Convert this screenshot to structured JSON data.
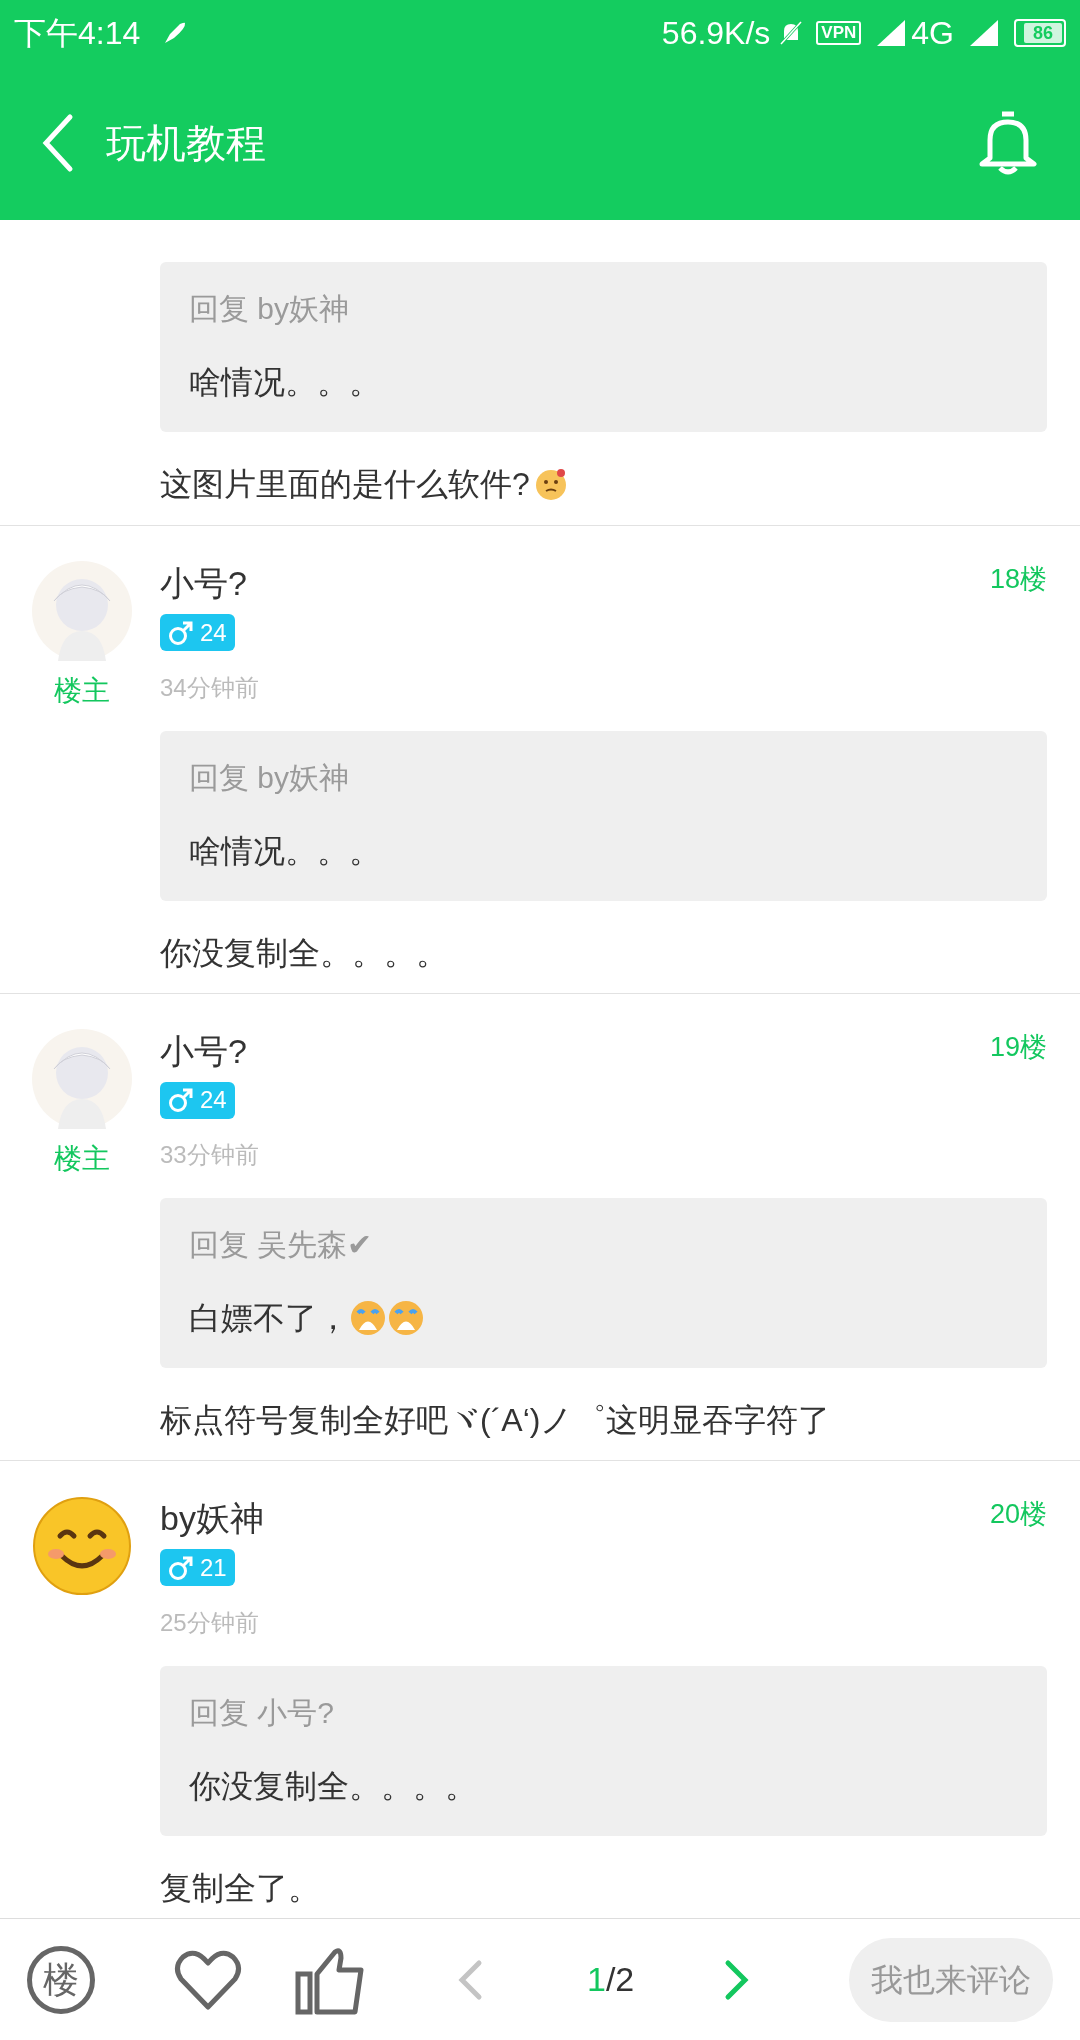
{
  "status_bar": {
    "time": "下午4:14",
    "speed": "56.9K/s",
    "vpn": "VPN",
    "network": "4G",
    "battery": "86"
  },
  "header": {
    "title": "玩机教程"
  },
  "posts": [
    {
      "kind": "partial",
      "quote": {
        "reply_to": "回复 by妖神",
        "text": "啥情况。。。"
      },
      "content": "这图片里面的是什么软件?",
      "emojis": [
        {
          "kind": "thinking"
        }
      ]
    },
    {
      "kind": "full",
      "avatar": {
        "kind": "figure"
      },
      "username": "小号?",
      "level": "24",
      "op_label": "楼主",
      "time": "34分钟前",
      "floor": "18楼",
      "quote": {
        "reply_to": "回复 by妖神",
        "text": "啥情况。。。"
      },
      "content": "你没复制全。。。。"
    },
    {
      "kind": "full",
      "avatar": {
        "kind": "figure"
      },
      "username": "小号?",
      "level": "24",
      "op_label": "楼主",
      "time": "33分钟前",
      "floor": "19楼",
      "quote": {
        "reply_to": "回复 吴先森✔",
        "text": "白嫖不了，",
        "emojis": [
          {
            "kind": "crying"
          },
          {
            "kind": "crying"
          }
        ]
      },
      "content": "标点符号复制全好吧ヾ(´A‘)ノ゜这明显吞字符了"
    },
    {
      "kind": "full",
      "avatar": {
        "kind": "smiley"
      },
      "username": "by妖神",
      "level": "21",
      "time": "25分钟前",
      "floor": "20楼",
      "quote": {
        "reply_to": "回复 小号?",
        "text": "你没复制全。。。。"
      },
      "content": "复制全了。"
    }
  ],
  "bottom_bar": {
    "floor_icon": "楼",
    "page_current": "1",
    "page_total": "/2",
    "prev_enabled": false,
    "next_enabled": true,
    "comment_button": "我也来评论"
  }
}
